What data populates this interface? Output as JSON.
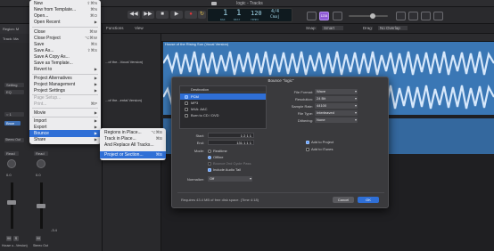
{
  "window": {
    "title": "logic - Tracks"
  },
  "transport": {
    "bar": "1",
    "beat": "1",
    "bar_label": "BAR",
    "beat_label": "BEAT",
    "tempo": "120",
    "tempo_label": "TEMPO",
    "signature": "4/4",
    "key": "Cmaj",
    "counter_badge": "1234"
  },
  "toolbar": {
    "functions": "Functions",
    "view": "View",
    "snap_label": "Snap:",
    "snap_value": "Smart",
    "drag_label": "Drag:",
    "drag_value": "No Overlap"
  },
  "left_panel": {
    "region_label": "Region: M",
    "track_label": "Track: Ma",
    "setting_label": "Setting",
    "eq_label": "EQ",
    "input_value": "○ 1",
    "stereo_out": "Stereo Out",
    "read_1": "Read",
    "read_2": "Read",
    "db_1": "0.0",
    "db_2": "0.0",
    "val_left": "-1.4",
    "val_right": "-3.4",
    "bnce": "Bnce",
    "ch_name_1": "House o...Version)",
    "ch_name_2": "Stereo Out",
    "m_label": "M",
    "s_label": "S"
  },
  "track_headers": {
    "track_1": "...of the...Vocal Version)",
    "track_2": "...of the...ental Version)"
  },
  "region": {
    "title": "House of the Rising Sun (Vocal Version)"
  },
  "main_menu": {
    "items": [
      {
        "label": "New",
        "shortcut": "⇧⌘N"
      },
      {
        "label": "New from Template...",
        "shortcut": "⌘N"
      },
      {
        "label": "Open...",
        "shortcut": "⌘O"
      },
      {
        "label": "Open Recent",
        "shortcut": "▶"
      },
      {
        "label": "Close",
        "shortcut": "⌘W"
      },
      {
        "label": "Close Project",
        "shortcut": "⌥⌘W"
      },
      {
        "label": "Save",
        "shortcut": "⌘S"
      },
      {
        "label": "Save As...",
        "shortcut": "⇧⌘S"
      },
      {
        "label": "Save A Copy As...",
        "shortcut": ""
      },
      {
        "label": "Save as Template...",
        "shortcut": ""
      },
      {
        "label": "Revert to",
        "shortcut": "▶"
      },
      {
        "label": "Project Alternatives",
        "shortcut": "▶"
      },
      {
        "label": "Project Management",
        "shortcut": "▶"
      },
      {
        "label": "Project Settings",
        "shortcut": "▶"
      },
      {
        "label": "Page Setup...",
        "shortcut": ""
      },
      {
        "label": "Print...",
        "shortcut": "⌘P"
      },
      {
        "label": "Movie",
        "shortcut": "▶"
      },
      {
        "label": "Import",
        "shortcut": "▶"
      },
      {
        "label": "Export",
        "shortcut": "▶"
      },
      {
        "label": "Bounce",
        "shortcut": "▶"
      },
      {
        "label": "Share",
        "shortcut": "▶"
      }
    ]
  },
  "bounce_submenu": {
    "items": [
      {
        "label": "Regions in Place...",
        "shortcut": "⌥⌘B"
      },
      {
        "label": "Track in Place...",
        "shortcut": "⌘B"
      },
      {
        "label": "And Replace All Tracks...",
        "shortcut": ""
      },
      {
        "label": "Project or Section...",
        "shortcut": "⌘B"
      }
    ]
  },
  "bounce_dialog": {
    "title": "Bounce \"logic\"",
    "destination_header": "Destination",
    "destinations": [
      {
        "label": "PCM",
        "checked": true
      },
      {
        "label": "MP3",
        "checked": false
      },
      {
        "label": "M4A: AAC",
        "checked": false
      },
      {
        "label": "Burn to CD / DVD",
        "checked": false
      }
    ],
    "start_label": "Start:",
    "start_value": "1  2  1     1",
    "end_label": "End:",
    "end_value": "131  1  1     1",
    "mode_label": "Mode:",
    "mode_realtime": "Realtime",
    "mode_offline": "Offline",
    "bounce_2nd_cycle": "Bounce 2nd Cycle Pass",
    "include_audio_tail": "Include Audio Tail",
    "normalize_label": "Normalize:",
    "normalize_value": "Off",
    "file_format_label": "File Format:",
    "file_format_value": "Wave",
    "resolution_label": "Resolution:",
    "resolution_value": "24 Bit",
    "sample_rate_label": "Sample Rate:",
    "sample_rate_value": "44100",
    "file_type_label": "File Type:",
    "file_type_value": "Interleaved",
    "dithering_label": "Dithering:",
    "dithering_value": "None",
    "add_to_project": "Add to Project",
    "add_to_itunes": "Add to iTunes",
    "disk_info": "Requires 43.4 MB of free disk space. (Time 4:18)",
    "cancel": "Cancel",
    "ok": "OK"
  },
  "colors": {
    "accent": "#2f6fd6",
    "region_blue": "#3a77b5",
    "record_red": "#e0363b"
  }
}
